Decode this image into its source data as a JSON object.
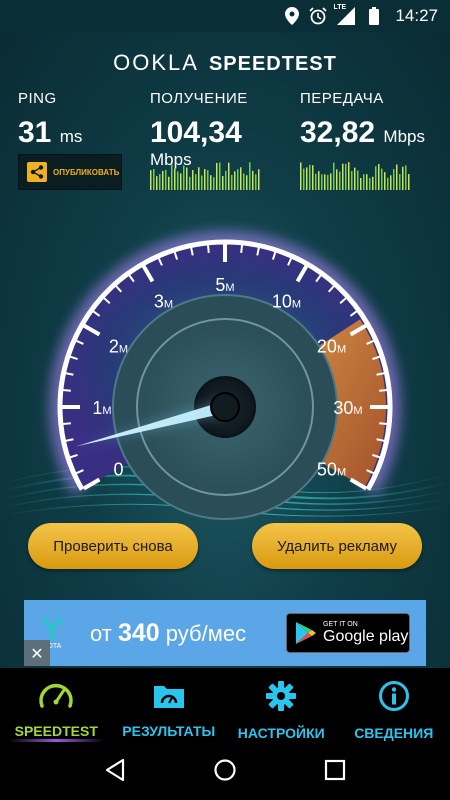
{
  "status_bar": {
    "time": "14:27",
    "network": "LTE",
    "icons": [
      "location-icon",
      "alarm-icon",
      "signal-icon",
      "battery-icon"
    ]
  },
  "brand": {
    "logo": "OOKLA",
    "product": "SPEEDTEST"
  },
  "ping": {
    "label": "PING",
    "value": "31",
    "unit": "ms"
  },
  "download": {
    "label": "ПОЛУЧЕНИЕ",
    "value": "104,34",
    "unit": "Mbps"
  },
  "upload": {
    "label": "ПЕРЕДАЧА",
    "value": "32,82",
    "unit": "Mbps"
  },
  "share": {
    "label": "ОПУБЛИКОВАТЬ"
  },
  "gauge": {
    "ticks": [
      {
        "num": "0",
        "unit": ""
      },
      {
        "num": "1",
        "unit": "M"
      },
      {
        "num": "2",
        "unit": "M"
      },
      {
        "num": "3",
        "unit": "M"
      },
      {
        "num": "5",
        "unit": "M"
      },
      {
        "num": "10",
        "unit": "M"
      },
      {
        "num": "20",
        "unit": "M"
      },
      {
        "num": "30",
        "unit": "M"
      },
      {
        "num": "50",
        "unit": "M"
      }
    ],
    "needle_fraction": 0.03
  },
  "buttons": {
    "retry": "Проверить снова",
    "remove_ads": "Удалить рекламу"
  },
  "ad": {
    "brand": "YOTA",
    "prefix": "от",
    "price": "340",
    "suffix": "руб/мес",
    "store_top": "GET IT ON",
    "store_name": "Google play",
    "close": "✕"
  },
  "nav": {
    "items": [
      {
        "label": "SPEEDTEST",
        "icon": "speedometer-icon",
        "active": true
      },
      {
        "label": "РЕЗУЛЬТАТЫ",
        "icon": "results-icon",
        "active": false
      },
      {
        "label": "НАСТРОЙКИ",
        "icon": "settings-gear-icon",
        "active": false
      },
      {
        "label": "СВЕДЕНИЯ",
        "icon": "info-icon",
        "active": false
      }
    ]
  },
  "colors": {
    "accent_gold": "#f0b021",
    "nav_blue": "#29c5ee",
    "nav_active": "#a4d734",
    "gauge_orange": "#e0822a"
  }
}
